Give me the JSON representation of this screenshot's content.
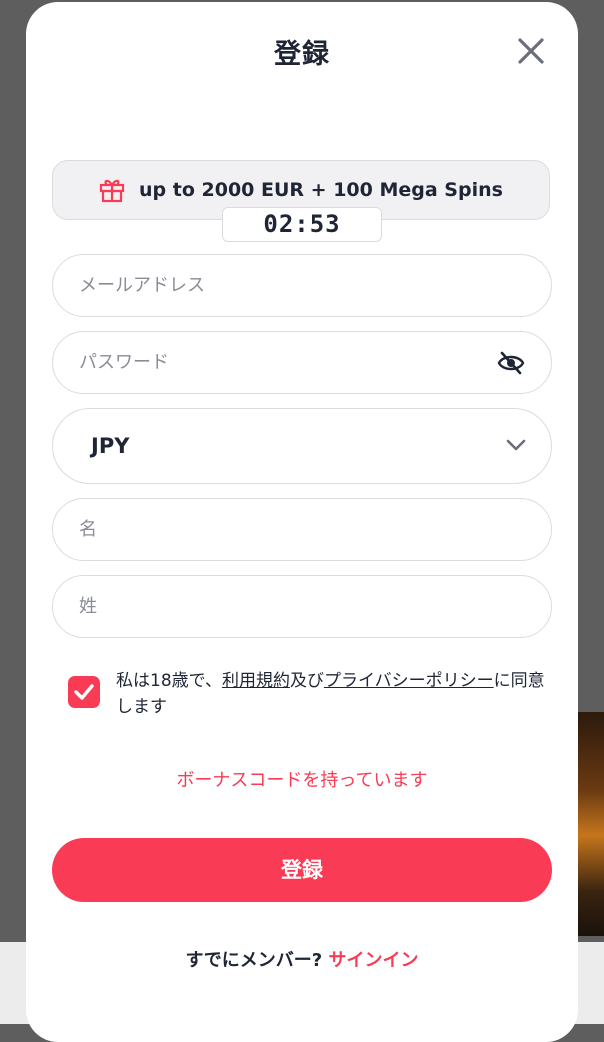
{
  "modal": {
    "title": "登録"
  },
  "bonus": {
    "text": "up to 2000 EUR + 100 Mega Spins",
    "timer": "02:53"
  },
  "form": {
    "email_placeholder": "メールアドレス",
    "password_placeholder": "パスワード",
    "currency_value": "JPY",
    "first_name_placeholder": "名",
    "last_name_placeholder": "姓"
  },
  "terms": {
    "checked": true,
    "prefix": "私は18歳で、",
    "terms_link": "利用規約",
    "middle": "及び",
    "privacy_link": "プライバシーポリシー",
    "suffix": "に同意します"
  },
  "bonus_code_link": "ボーナスコードを持っています",
  "register_button": "登録",
  "footer": {
    "question": "すでにメンバー?",
    "signin_link": "サインイン"
  },
  "colors": {
    "accent": "#fa3b55",
    "text": "#1f2535",
    "placeholder": "#8a8d96",
    "border": "#dcdce0"
  },
  "icons": {
    "close": "close-icon",
    "gift": "gift-icon",
    "password_toggle": "eye-off-icon",
    "dropdown": "chevron-down-icon",
    "check": "check-icon"
  }
}
